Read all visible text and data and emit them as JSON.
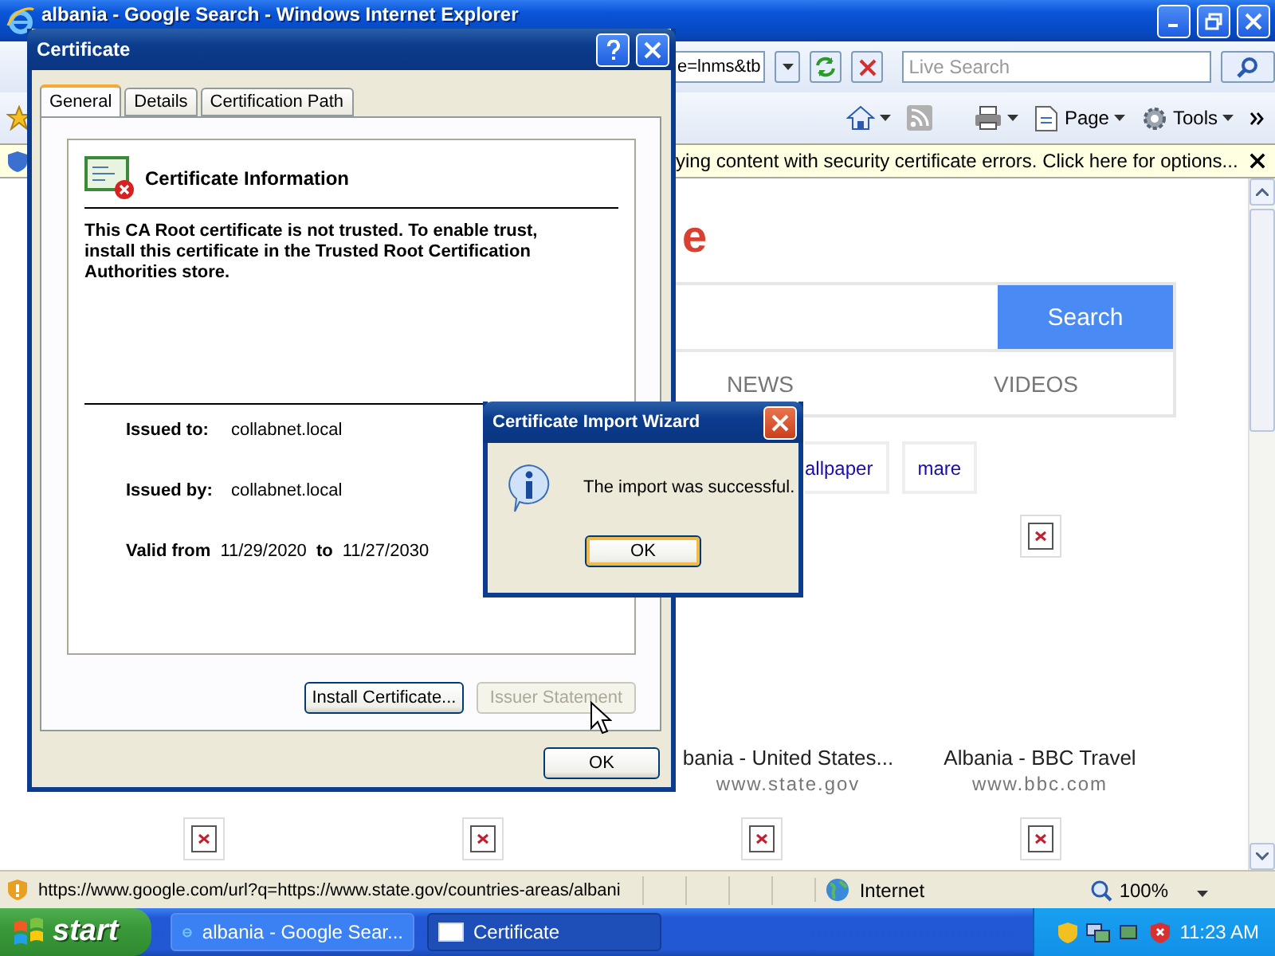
{
  "browser": {
    "title": "albania - Google Search - Windows Internet Explorer",
    "address": {
      "value": "e=lnms&tb"
    },
    "live_search": {
      "placeholder": "Live Search"
    },
    "toolbar": [
      {
        "kind": "home"
      },
      {
        "kind": "feeds"
      },
      {
        "kind": "print"
      },
      {
        "kind": "page",
        "label": "Page"
      },
      {
        "kind": "tools",
        "label": "Tools"
      }
    ],
    "info_bar": {
      "text": "ying content with security certificate errors. Click here for options..."
    },
    "page": {
      "logo_fragment": "e",
      "search_button": "Search",
      "tabs": [
        "NEWS",
        "VIDEOS"
      ],
      "chips": [
        "allpaper",
        "mare"
      ],
      "results": [
        {
          "title": "bania - United States...",
          "site": "www.state.gov"
        },
        {
          "title": "Albania - BBC Travel",
          "site": "www.bbc.com"
        }
      ]
    },
    "status_bar": {
      "url": "https://www.google.com/url?q=https://www.state.gov/countries-areas/albani",
      "zone": "Internet",
      "zoom": "100%"
    }
  },
  "certificate_dialog": {
    "title": "Certificate",
    "tabs": [
      {
        "label": "General",
        "selected": true
      },
      {
        "label": "Details",
        "selected": false
      },
      {
        "label": "Certification Path",
        "selected": false
      }
    ],
    "heading": "Certificate Information",
    "message": "This CA Root certificate is not trusted. To enable trust, install this certificate in the Trusted Root Certification Authorities store.",
    "fields": [
      {
        "label": "Issued to:",
        "value": "collabnet.local"
      },
      {
        "label": "Issued by:",
        "value": "collabnet.local"
      }
    ],
    "validity": {
      "label": "Valid from",
      "from": "11/29/2020",
      "to_label": "to",
      "to": "11/27/2030"
    },
    "buttons": [
      {
        "label": "Install Certificate...",
        "disabled": false
      },
      {
        "label": "Issuer Statement",
        "disabled": true
      }
    ],
    "ok": "OK"
  },
  "wizard_dialog": {
    "title": "Certificate Import Wizard",
    "message": "The import was successful.",
    "button": {
      "label": "OK",
      "focused": true
    }
  },
  "taskbar": {
    "start": "start",
    "tasks": [
      {
        "label": "albania - Google Sear...",
        "selected": false
      },
      {
        "label": "Certificate",
        "selected": true
      }
    ],
    "clock": "11:23 AM"
  }
}
